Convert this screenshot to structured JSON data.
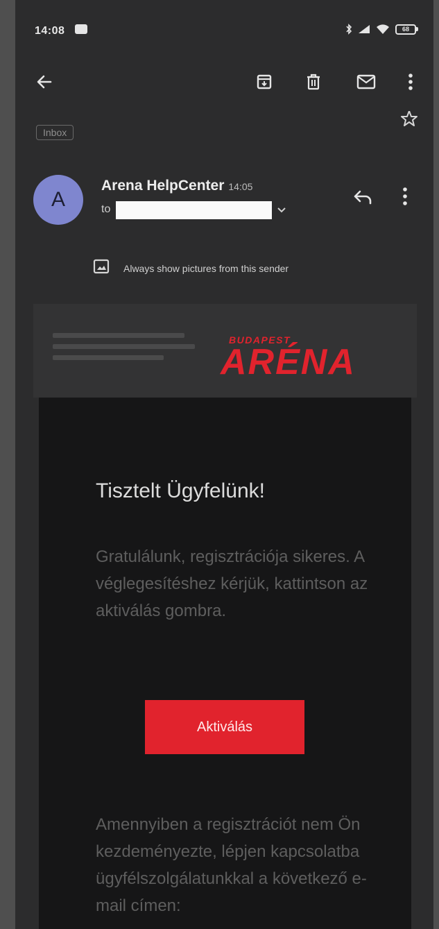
{
  "status": {
    "time": "14:08",
    "battery": "68"
  },
  "email": {
    "label": "Inbox",
    "sender_initial": "A",
    "sender_name": "Arena HelpCenter",
    "sent_time": "14:05",
    "to_label": "to",
    "show_pictures_text": "Always show pictures from this sender"
  },
  "brand": {
    "logo_small": "BUDAPEST",
    "logo_big": "ARÉNA",
    "accent": "#e1232d"
  },
  "body": {
    "greeting": "Tisztelt Ügyfelünk!",
    "paragraph1": "Gratulálunk, regisztrációja sikeres. A véglegesítéshez kérjük, kattintson az aktiválás gombra.",
    "button_label": "Aktiválás",
    "paragraph2": "Amennyiben a regisztrációt nem Ön kezdeményezte, lépjen kapcsolatba ügyfélszolgálatunkkal a következő e-mail címen:"
  },
  "icons": [
    "back-arrow-icon",
    "archive-icon",
    "delete-icon",
    "mark-unread-icon",
    "more-vert-icon",
    "star-icon",
    "reply-icon",
    "image-icon",
    "chevron-down-icon"
  ]
}
